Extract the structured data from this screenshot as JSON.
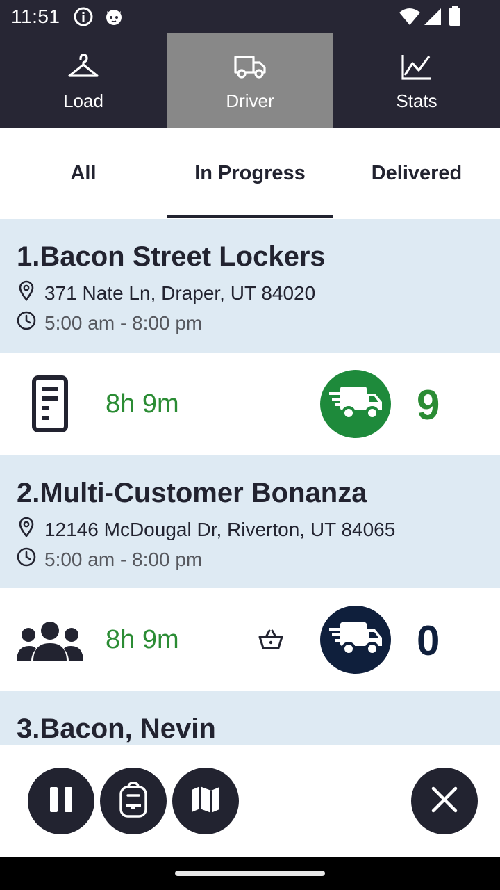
{
  "status_bar": {
    "time": "11:51",
    "icons": [
      "info-icon",
      "cat-icon",
      "wifi-icon",
      "signal-icon",
      "battery-icon"
    ]
  },
  "top_nav": {
    "items": [
      {
        "label": "Load",
        "icon": "hanger-icon",
        "active": false
      },
      {
        "label": "Driver",
        "icon": "truck-icon",
        "active": true
      },
      {
        "label": "Stats",
        "icon": "line-chart-icon",
        "active": false
      }
    ]
  },
  "sub_tabs": {
    "items": [
      {
        "label": "All",
        "active": false
      },
      {
        "label": "In Progress",
        "active": true
      },
      {
        "label": "Delivered",
        "active": false
      }
    ]
  },
  "stops": [
    {
      "title": "1.Bacon Street Lockers",
      "address": "371 Nate Ln, Draper, UT 84020",
      "hours": "5:00 am - 8:00 pm",
      "row_icon": "locker-icon",
      "duration": "8h 9m",
      "truck_color": "#1e8a3b",
      "count": "9"
    },
    {
      "title": "2.Multi-Customer Bonanza",
      "address": "12146 McDougal Dr, Riverton, UT 84065",
      "hours": "5:00 am - 8:00 pm",
      "row_icon": "users-icon",
      "extra_icon": "basket-icon",
      "duration": "8h 9m",
      "truck_color": "#0f1f3c",
      "count": "0"
    },
    {
      "title": "3.Bacon, Nevin"
    }
  ],
  "actions": {
    "buttons": [
      "pause-icon",
      "backpack-icon",
      "map-icon",
      "close-icon"
    ]
  },
  "colors": {
    "dark": "#272634",
    "active_tab": "#888888",
    "header_bg": "#deeaf3",
    "green": "#2b8c34",
    "navy": "#0f1f3c"
  }
}
